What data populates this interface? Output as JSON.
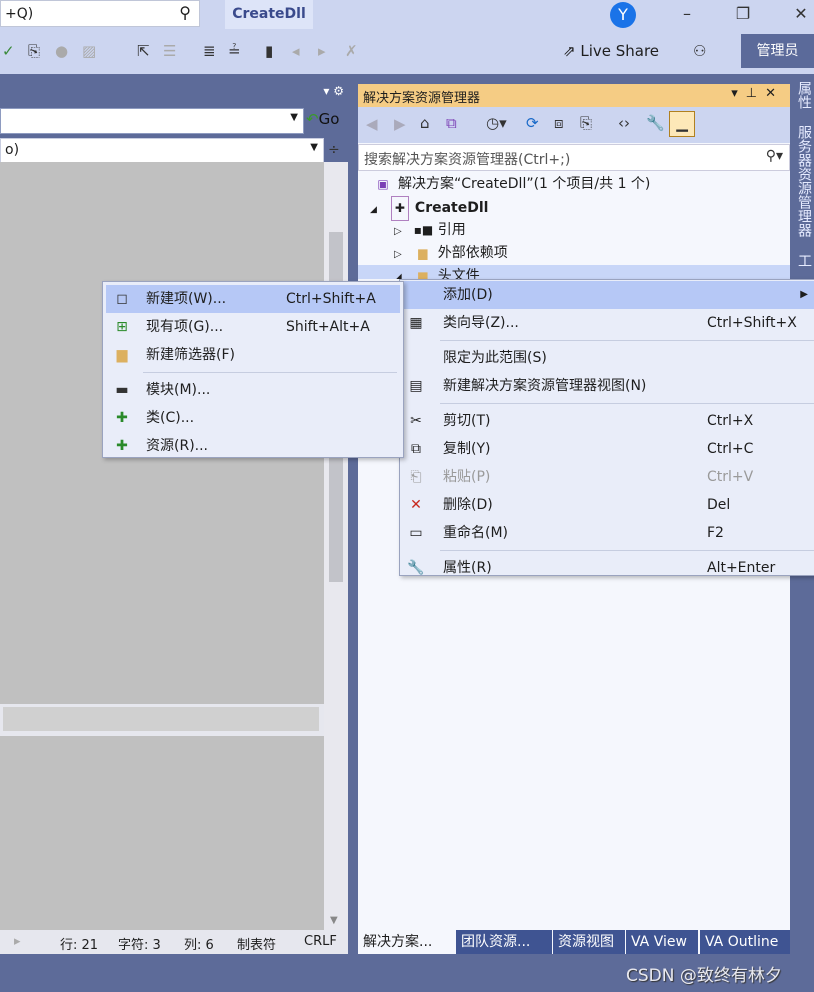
{
  "topbar": {
    "search_text": "+Q)",
    "title": "CreateDll",
    "avatar": "Y"
  },
  "toolbar": {
    "live_share": "Live Share",
    "admin": "管理员"
  },
  "left_panel": {
    "go": "Go",
    "combo2_text": "o)"
  },
  "status": {
    "line": "行: 21",
    "char": "字符: 3",
    "col": "列: 6",
    "tab": "制表符",
    "eol": "CRLF"
  },
  "solution_explorer": {
    "title": "解决方案资源管理器",
    "search_placeholder": "搜索解决方案资源管理器(Ctrl+;)",
    "tree": [
      {
        "label": "解决方案“CreateDll”(1 个项目/共 1 个)",
        "icon": "solution-icon"
      },
      {
        "label": "CreateDll",
        "icon": "project-icon",
        "expanded": true
      },
      {
        "label": "引用",
        "icon": "reference-icon"
      },
      {
        "label": "外部依赖项",
        "icon": "folder-icon"
      },
      {
        "label": "头文件",
        "icon": "folder-icon"
      }
    ],
    "tabs": [
      "解决方案...",
      "团队资源...",
      "资源视图",
      "VA View",
      "VA Outline"
    ]
  },
  "right_strip": [
    "属性",
    "服务器资源管理器",
    "工"
  ],
  "context_menu": [
    {
      "label": "添加(D)",
      "shortcut": "",
      "icon": "",
      "submenu": true
    },
    {
      "label": "类向导(Z)...",
      "shortcut": "Ctrl+Shift+X",
      "icon": "class-wizard-icon"
    },
    {
      "label": "限定为此范围(S)",
      "shortcut": "",
      "icon": ""
    },
    {
      "label": "新建解决方案资源管理器视图(N)",
      "shortcut": "",
      "icon": "new-view-icon"
    },
    {
      "label": "剪切(T)",
      "shortcut": "Ctrl+X",
      "icon": "cut-icon"
    },
    {
      "label": "复制(Y)",
      "shortcut": "Ctrl+C",
      "icon": "copy-icon"
    },
    {
      "label": "粘贴(P)",
      "shortcut": "Ctrl+V",
      "icon": "paste-icon",
      "disabled": true
    },
    {
      "label": "删除(D)",
      "shortcut": "Del",
      "icon": "delete-icon"
    },
    {
      "label": "重命名(M)",
      "shortcut": "F2",
      "icon": "rename-icon"
    },
    {
      "label": "属性(R)",
      "shortcut": "Alt+Enter",
      "icon": "wrench-icon"
    }
  ],
  "submenu": [
    {
      "label": "新建项(W)...",
      "shortcut": "Ctrl+Shift+A",
      "icon": "new-item-icon"
    },
    {
      "label": "现有项(G)...",
      "shortcut": "Shift+Alt+A",
      "icon": "existing-item-icon"
    },
    {
      "label": "新建筛选器(F)",
      "shortcut": "",
      "icon": "new-filter-icon"
    },
    {
      "label": "模块(M)...",
      "shortcut": "",
      "icon": "module-icon"
    },
    {
      "label": "类(C)...",
      "shortcut": "",
      "icon": "class-icon"
    },
    {
      "label": "资源(R)...",
      "shortcut": "",
      "icon": "resource-icon"
    }
  ],
  "watermark": "CSDN @致终有林夕",
  "colors": {
    "accent_title": "#f5cc84",
    "frame": "#5d6b99",
    "menu_highlight": "#b6c8f6"
  }
}
